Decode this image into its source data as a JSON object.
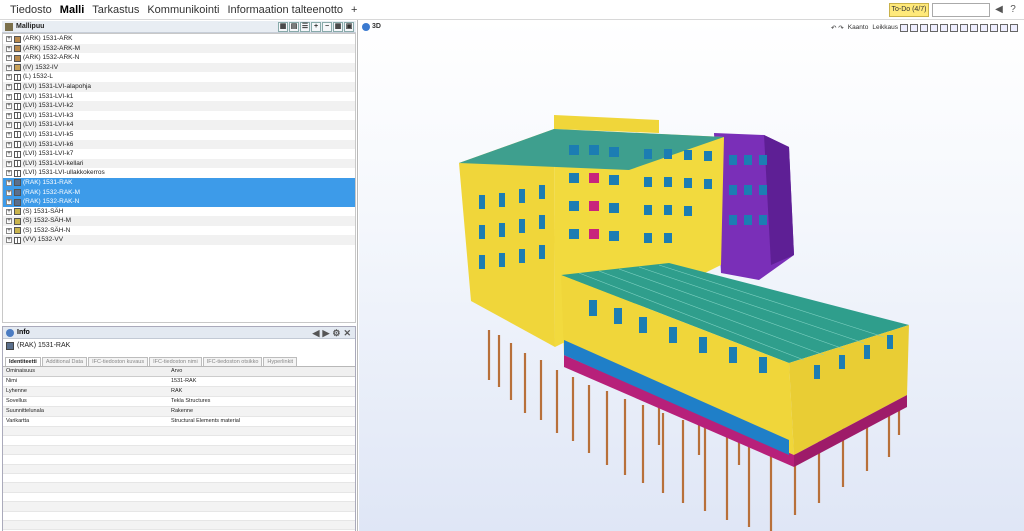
{
  "menu": {
    "items": [
      "Tiedosto",
      "Malli",
      "Tarkastus",
      "Kommunikointi",
      "Informaation talteenotto",
      "+"
    ],
    "active": "Malli"
  },
  "todo": {
    "label": "To-Do (4/7)"
  },
  "search": {
    "placeholder": ""
  },
  "tree": {
    "header": "Mallipuu",
    "rows": [
      {
        "label": "(ARK) 1531-ARK",
        "icon": "ark-icon",
        "selected": false
      },
      {
        "label": "(ARK) 1532-ARK-M",
        "icon": "ark-icon",
        "selected": false
      },
      {
        "label": "(ARK) 1532-ARK-N",
        "icon": "ark-icon",
        "selected": false
      },
      {
        "label": "(IV) 1532-IV",
        "icon": "iv-icon",
        "selected": false
      },
      {
        "label": "(L) 1532-L",
        "icon": "grid-icon",
        "selected": false
      },
      {
        "label": "(LVI) 1531-LVI-alapohja",
        "icon": "grid-icon",
        "selected": false
      },
      {
        "label": "(LVI) 1531-LVI-k1",
        "icon": "grid-icon",
        "selected": false
      },
      {
        "label": "(LVI) 1531-LVI-k2",
        "icon": "grid-icon",
        "selected": false
      },
      {
        "label": "(LVI) 1531-LVI-k3",
        "icon": "grid-icon",
        "selected": false
      },
      {
        "label": "(LVI) 1531-LVI-k4",
        "icon": "grid-icon",
        "selected": false
      },
      {
        "label": "(LVI) 1531-LVI-k5",
        "icon": "grid-icon",
        "selected": false
      },
      {
        "label": "(LVI) 1531-LVI-k6",
        "icon": "grid-icon",
        "selected": false
      },
      {
        "label": "(LVI) 1531-LVI-k7",
        "icon": "grid-icon",
        "selected": false
      },
      {
        "label": "(LVI) 1531-LVI-kellari",
        "icon": "grid-icon",
        "selected": false
      },
      {
        "label": "(LVI) 1531-LVI-ullakkokerros",
        "icon": "grid-icon",
        "selected": false
      },
      {
        "label": "(RAK) 1531-RAK",
        "icon": "rak-icon",
        "selected": true
      },
      {
        "label": "(RAK) 1532-RAK-M",
        "icon": "rak-icon",
        "selected": true
      },
      {
        "label": "(RAK) 1532-RAK-N",
        "icon": "rak-icon",
        "selected": true
      },
      {
        "label": "(S) 1531-SÄH",
        "icon": "s-icon",
        "selected": false
      },
      {
        "label": "(S) 1532-SÄH-M",
        "icon": "s-icon",
        "selected": false
      },
      {
        "label": "(S) 1532-SÄH-N",
        "icon": "s-icon",
        "selected": false
      },
      {
        "label": "(VV) 1532-VV",
        "icon": "grid-icon",
        "selected": false
      }
    ]
  },
  "info": {
    "header": "Info",
    "title": "(RAK) 1531-RAK",
    "tabs": [
      "Identiteetti",
      "Additional Data",
      "IFC-tiedoston kuvaus",
      "IFC-tiedoston nimi",
      "IFC-tiedoston otsikko",
      "Hyperlinkit"
    ],
    "active_tab": "Identiteetti",
    "columns": [
      "Ominaisuus",
      "Arvo"
    ],
    "rows": [
      [
        "Nimi",
        "1531-RAK"
      ],
      [
        "Lyhenne",
        "RAK"
      ],
      [
        "Sovellus",
        "Tekla Structures"
      ],
      [
        "Suunnittelunala",
        "Rakenne"
      ],
      [
        "Varikartta",
        "Structural Elements material"
      ]
    ]
  },
  "viewport": {
    "label": "3D",
    "toolbar": [
      "Kaanto",
      "Leikkaus"
    ]
  },
  "colors": {
    "selection": "#3d9be9",
    "facade": "#f0d63a",
    "roof": "#2f9e8c",
    "tower_purple": "#7a2fb8",
    "slab_magenta": "#b7207a",
    "piles": "#b8703a",
    "base_blue": "#1f7fc8"
  }
}
